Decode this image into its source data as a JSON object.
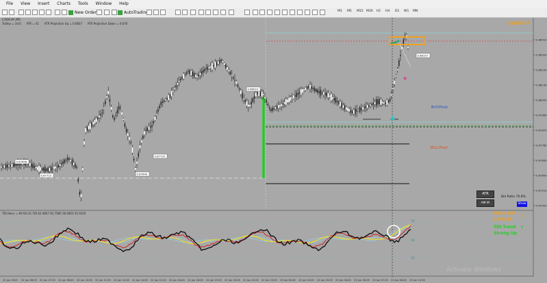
{
  "menu": [
    "File",
    "View",
    "Insert",
    "Charts",
    "Tools",
    "Window",
    "Help"
  ],
  "toolbar": {
    "new_order": "New Order",
    "autotrading": "AutoTrading",
    "timeframes": [
      "M1",
      "M5",
      "M15",
      "M30",
      "H1",
      "H4",
      "D1",
      "W1",
      "MN"
    ]
  },
  "chart": {
    "symbol": "CADCHF,M5",
    "indicator_line": "Tralley = 34.6      ATR = 41      ATR Projection Up = 0.6837      ATR Projection Down = 0.676",
    "symbol_watermark": "CADCHF",
    "buy_pivot": "BUY/Pivot",
    "sell_pivot": "SELL/Pivot",
    "bid_ratio": "Bid Ratio 70.8%",
    "atr_button": "ATR",
    "am_button": "AM IR",
    "show_button": "Show",
    "colors": {
      "buy": "#2050c0",
      "sell": "#d85020",
      "watermark": "#e8a020",
      "green": "#20c020",
      "orange": "#f0a020"
    }
  },
  "tdi": {
    "header": "TDI Hans = 46 RSI 21 TDI 62.4857 62.7585 58.5853 55.9335",
    "hook_label": "Hook Sell",
    "hook_value": "0.68238",
    "trend_label": "TDI Trend",
    "trend_value": "Strong Up",
    "levels": [
      "70",
      "50",
      "32"
    ]
  },
  "xaxis": [
    "22 Jun 2019",
    "22 Jun 06:05",
    "22 Jun 07:25",
    "22 Jun 08:45",
    "22 Jun 10:05",
    "22 Jun 11:25",
    "22 Jun 12:45",
    "22 Jun 14:05",
    "22 Jun 15:25",
    "22 Jun 16:45",
    "22 Jun 18:05",
    "22 Jun 19:25",
    "22 Jun 20:45",
    "22 Jun 22:05",
    "22 Jun 23:25",
    "23 Jun 00:45",
    "23 Jun 02:05",
    "23 Jun 03:25",
    "23 Jun 04:45",
    "23 Jun 06:05",
    "23 Jun 07:25",
    "23 Jun 08:45",
    "23 Jun 10:05"
  ],
  "yaxis": [
    "0.68410",
    "0.68320",
    "0.68230",
    "0.68140",
    "0.68050",
    "0.67960",
    "0.67870",
    "0.67780",
    "0.67690",
    "0.67600",
    "0.67510",
    "0.67420"
  ],
  "price_tags": [
    "0.67858",
    "0.67715",
    "0.67720",
    "0.67640",
    "0.68010",
    "0.68157"
  ],
  "watermark_text": "Activate Windows"
}
